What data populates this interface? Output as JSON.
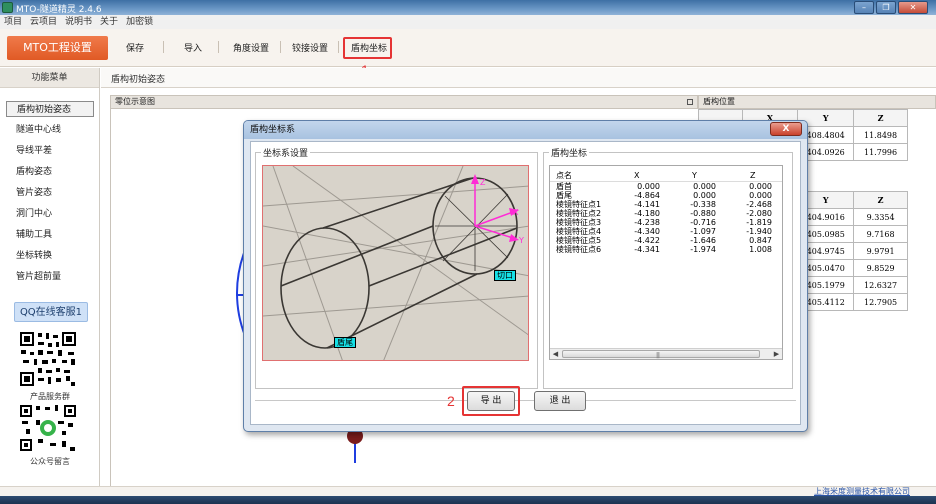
{
  "window": {
    "title": "MTO-隧道精灵 2.4.6",
    "buttons": {
      "minimize": "–",
      "restore": "❐",
      "close": "✕"
    }
  },
  "menubar": [
    "项目",
    "云项目",
    "说明书",
    "关于",
    "加密锁"
  ],
  "toolbar": {
    "project_settings": "MTO工程设置",
    "save": "保存",
    "import": "导入",
    "angle_settings": "角度设置",
    "hinge_settings": "铰接设置",
    "shield_coordinates": "盾构坐标",
    "annotation_1": "1"
  },
  "sidebar": {
    "header": "功能菜单",
    "items": [
      "盾构初始姿态",
      "隧道中心线",
      "导线平差",
      "盾构姿态",
      "管片姿态",
      "洞门中心",
      "辅助工具",
      "坐标转换",
      "管片超前量"
    ],
    "qq_button": "QQ在线客服1",
    "qr1_caption": "产品服务群",
    "qr2_caption": "公众号留言"
  },
  "main": {
    "tab": "盾构初始姿态",
    "diagram_title": "零位示意图",
    "position_title": "盾构位置"
  },
  "right_table_1": {
    "headers": [
      "",
      "X",
      "Y",
      "Z"
    ],
    "rows": [
      [
        "",
        "",
        "408.4804",
        "11.8498"
      ],
      [
        "",
        "",
        "404.0926",
        "11.7996"
      ]
    ]
  },
  "right_table_2": {
    "headers": [
      "",
      "Y",
      "Z"
    ],
    "rows": [
      [
        "",
        "404.9016",
        "9.3354"
      ],
      [
        "",
        "405.0985",
        "9.7168"
      ],
      [
        "",
        "404.9745",
        "9.9791"
      ],
      [
        "",
        "405.0470",
        "9.8529"
      ],
      [
        "",
        "405.1979",
        "12.6327"
      ],
      [
        "",
        "405.4112",
        "12.7905"
      ]
    ]
  },
  "footer": {
    "company_link": "上海米度测量技术有限公司"
  },
  "dialog": {
    "title": "盾构坐标系",
    "close": "X",
    "coord_group": "坐标系设置",
    "shield_group": "盾构坐标",
    "tag_tail": "盾尾",
    "tag_cut": "切口",
    "axis_z": "Z",
    "axis_x": "X",
    "axis_y": "Y",
    "table": {
      "headers": [
        "点名",
        "X",
        "Y",
        "Z"
      ],
      "rows": [
        [
          "盾首",
          "0.000",
          "0.000",
          "0.000"
        ],
        [
          "盾尾",
          "-4.864",
          "0.000",
          "0.000"
        ],
        [
          "棱镜特征点1",
          "-4.141",
          "-0.338",
          "-2.468"
        ],
        [
          "棱镜特征点2",
          "-4.180",
          "-0.880",
          "-2.080"
        ],
        [
          "棱镜特征点3",
          "-4.238",
          "-0.716",
          "-1.819"
        ],
        [
          "棱镜特征点4",
          "-4.340",
          "-1.097",
          "-1.940"
        ],
        [
          "棱镜特征点5",
          "-4.422",
          "-1.646",
          "0.847"
        ],
        [
          "棱镜特征点6",
          "-4.341",
          "-1.974",
          "1.008"
        ]
      ]
    },
    "export": "导 出",
    "exit": "退 出",
    "annotation_2": "2"
  }
}
